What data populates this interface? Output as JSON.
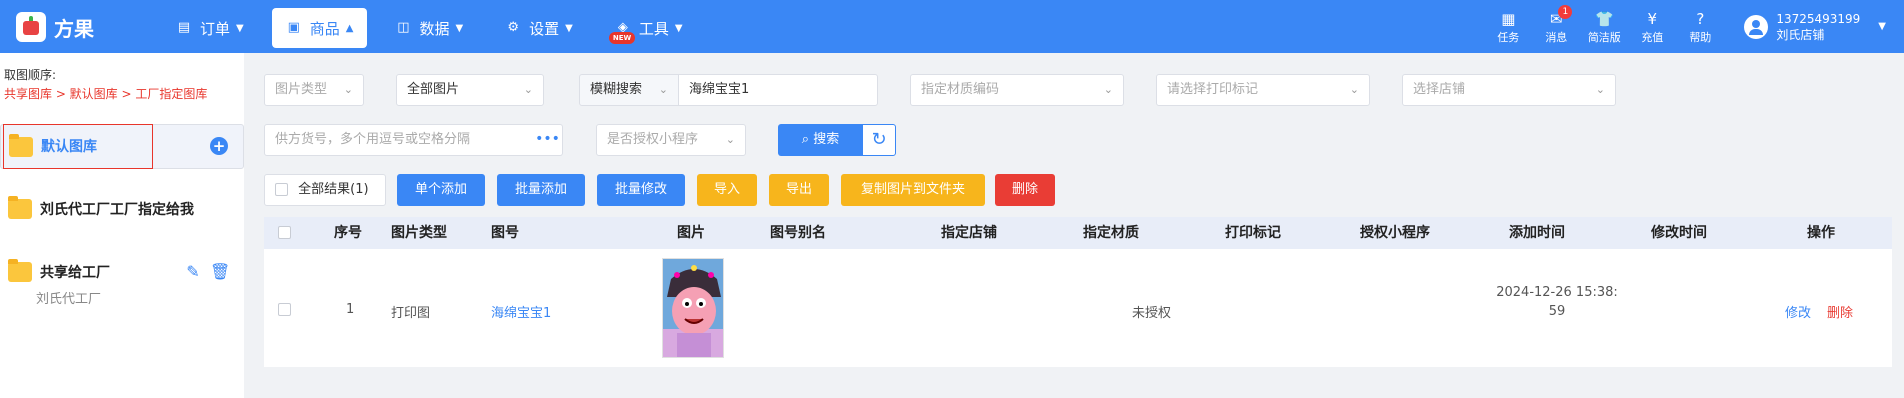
{
  "brand": {
    "name": "方果"
  },
  "nav": [
    {
      "label": "订单",
      "icon": "briefcase-icon"
    },
    {
      "label": "商品",
      "icon": "bag-icon"
    },
    {
      "label": "数据",
      "icon": "chart-icon"
    },
    {
      "label": "设置",
      "icon": "gear-icon"
    },
    {
      "label": "工具",
      "icon": "box-icon",
      "badge": "NEW"
    }
  ],
  "topright": {
    "items": [
      {
        "label": "任务",
        "icon": "task-icon"
      },
      {
        "label": "消息",
        "icon": "message-icon",
        "badge": "1"
      },
      {
        "label": "简洁版",
        "icon": "shirt-icon"
      },
      {
        "label": "充值",
        "icon": "coin-icon"
      },
      {
        "label": "帮助",
        "icon": "help-icon"
      }
    ],
    "user": {
      "phone": "13725493199",
      "shop": "刘氏店铺"
    }
  },
  "sidebar": {
    "order_title": "取图顺序:",
    "order_path": "共享图库 > 默认图库 > 工厂指定图库",
    "folders": [
      {
        "name": "默认图库"
      },
      {
        "name": "刘氏代工厂工厂指定给我"
      },
      {
        "name": "共享给工厂",
        "sub": "刘氏代工厂"
      }
    ]
  },
  "filters": {
    "image_type": "图片类型",
    "all_images": "全部图片",
    "search_mode": "模糊搜索",
    "search_value": "海绵宝宝1",
    "material_code": "指定材质编码",
    "print_mark": "请选择打印标记",
    "shop": "选择店铺",
    "supplier_no": "供方货号，多个用逗号或空格分隔",
    "more": "•••",
    "authorized": "是否授权小程序",
    "search_btn": "搜索"
  },
  "actions": {
    "all_results": "全部结果(1)",
    "single_add": "单个添加",
    "batch_add": "批量添加",
    "batch_edit": "批量修改",
    "import": "导入",
    "export": "导出",
    "copy_to_folder": "复制图片到文件夹",
    "delete": "删除"
  },
  "table": {
    "headers": [
      "序号",
      "图片类型",
      "图号",
      "图片",
      "图号别名",
      "指定店铺",
      "指定材质",
      "打印标记",
      "授权小程序",
      "添加时间",
      "修改时间",
      "操作"
    ],
    "rows": [
      {
        "index": "1",
        "type": "打印图",
        "code": "海绵宝宝1",
        "alias": "",
        "shop": "",
        "material": "",
        "mark": "",
        "auth": "未授权",
        "added_date": "2024-12-26 15:38:",
        "added_sec": "59",
        "modified": "",
        "edit": "修改",
        "delete": "删除"
      }
    ]
  },
  "colors": {
    "primary": "#3a87f5",
    "warning": "#f7b51c",
    "danger": "#e93d35",
    "folder": "#fbc63d"
  }
}
